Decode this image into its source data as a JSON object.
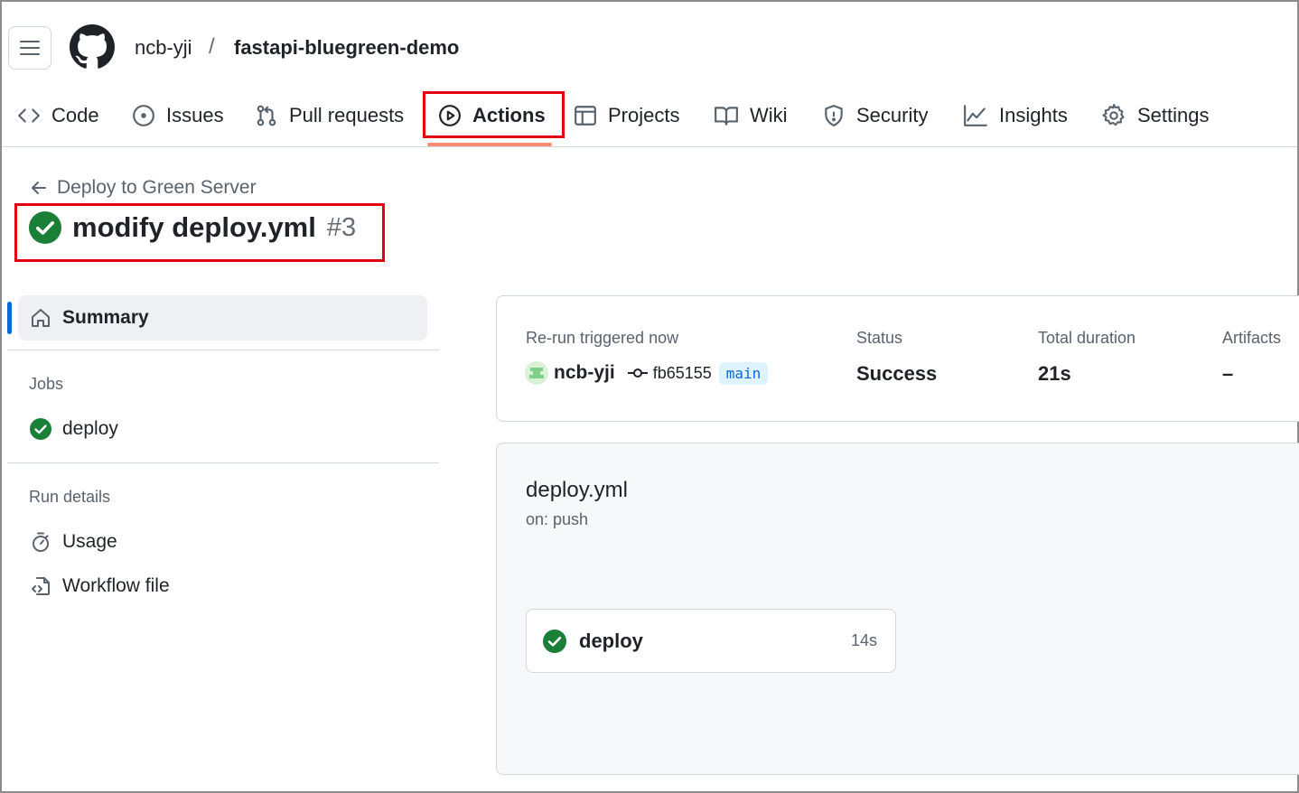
{
  "header": {
    "owner": "ncb-yji",
    "separator": "/",
    "repo": "fastapi-bluegreen-demo"
  },
  "tabs": [
    {
      "label": "Code",
      "icon": "code-icon"
    },
    {
      "label": "Issues",
      "icon": "issue-opened-icon"
    },
    {
      "label": "Pull requests",
      "icon": "git-pull-request-icon"
    },
    {
      "label": "Actions",
      "icon": "play-icon",
      "active": true
    },
    {
      "label": "Projects",
      "icon": "table-icon"
    },
    {
      "label": "Wiki",
      "icon": "book-icon"
    },
    {
      "label": "Security",
      "icon": "shield-icon"
    },
    {
      "label": "Insights",
      "icon": "graph-icon"
    },
    {
      "label": "Settings",
      "icon": "gear-icon"
    }
  ],
  "run": {
    "workflow_name": "Deploy to Green Server",
    "title": "modify deploy.yml",
    "number": "#3"
  },
  "sidebar": {
    "summary_label": "Summary",
    "jobs_heading": "Jobs",
    "jobs": [
      {
        "label": "deploy",
        "status": "success"
      }
    ],
    "run_details_heading": "Run details",
    "run_details": [
      {
        "label": "Usage",
        "icon": "stopwatch-icon"
      },
      {
        "label": "Workflow file",
        "icon": "file-code-icon"
      }
    ]
  },
  "summary_card": {
    "trigger_label": "Re-run triggered now",
    "actor": "ncb-yji",
    "commit": "fb65155",
    "branch": "main",
    "status_label": "Status",
    "status_value": "Success",
    "duration_label": "Total duration",
    "duration_value": "21s",
    "artifacts_label": "Artifacts",
    "artifacts_value": "–"
  },
  "workflow_card": {
    "file": "deploy.yml",
    "trigger": "on: push",
    "job_name": "deploy",
    "job_duration": "14s"
  },
  "colors": {
    "accent": "#0969da",
    "success": "#1a7f37",
    "tab_underline": "#fd8c73",
    "highlight_box": "#e3000f"
  }
}
